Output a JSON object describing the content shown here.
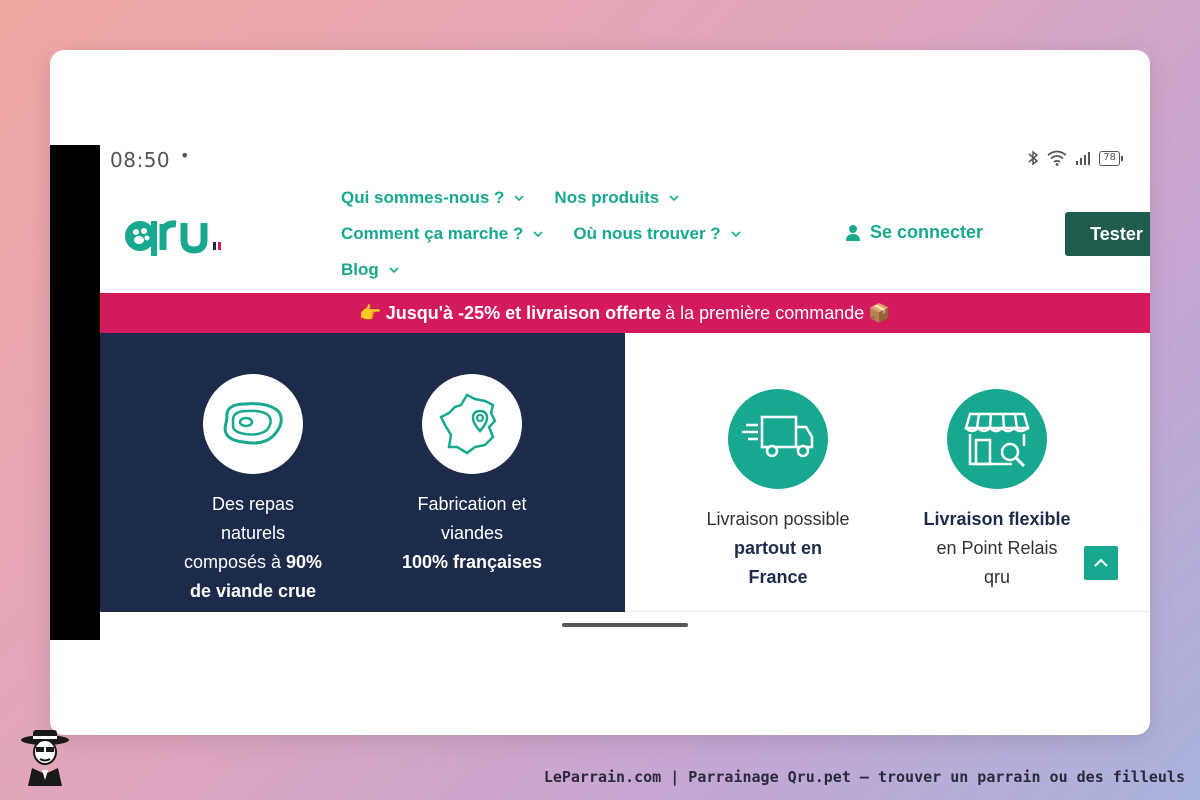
{
  "status_bar": {
    "time": "08:50",
    "dot": "•",
    "battery": "78"
  },
  "brand": {
    "logo_text": "qru",
    "teal": "#18a88f",
    "navy": "#1c2b4a",
    "pink": "#d4195c",
    "dark_green": "#1f5c4e"
  },
  "nav": {
    "rows": [
      [
        {
          "label": "Qui sommes-nous ?"
        },
        {
          "label": "Nos produits"
        }
      ],
      [
        {
          "label": "Comment ça marche ?"
        },
        {
          "label": "Où nous trouver ?"
        }
      ],
      [
        {
          "label": "Blog"
        }
      ]
    ]
  },
  "header": {
    "login_label": "Se connecter",
    "cta_label": "Tester"
  },
  "promo": {
    "emoji_start": "👉",
    "bold": "Jusqu'à -25% et livraison offerte",
    "rest": "à la première commande",
    "emoji_end": "📦"
  },
  "features": {
    "meat": {
      "l1": "Des repas",
      "l2": "naturels",
      "l3a": "composés à ",
      "l3b": "90%",
      "l4": "de viande crue",
      "icon": "steak-icon"
    },
    "france": {
      "l1": "Fabrication et",
      "l2": "viandes",
      "l3": "100% françaises",
      "icon": "france-map-icon"
    },
    "delivery": {
      "l1": "Livraison possible",
      "l2": "partout en",
      "l3": "France",
      "icon": "truck-icon"
    },
    "relay": {
      "l1": "Livraison flexible",
      "l2": "en Point Relais",
      "l3": "qru",
      "icon": "shop-icon"
    }
  },
  "footer": {
    "caption": "LeParrain.com | Parrainage Qru.pet — trouver un parrain ou des filleuls"
  }
}
